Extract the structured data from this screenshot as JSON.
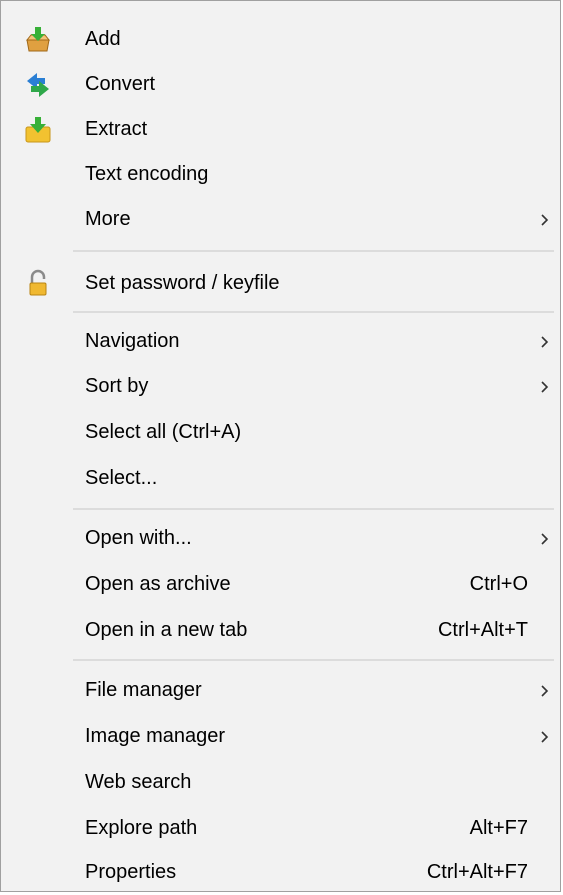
{
  "menu": {
    "items": [
      {
        "label": "Add",
        "icon": "add-archive-icon",
        "shortcut": "",
        "submenu": false
      },
      {
        "label": "Convert",
        "icon": "convert-icon",
        "shortcut": "",
        "submenu": false
      },
      {
        "label": "Extract",
        "icon": "extract-icon",
        "shortcut": "",
        "submenu": false
      },
      {
        "label": "Text encoding",
        "icon": "",
        "shortcut": "",
        "submenu": false
      },
      {
        "label": "More",
        "icon": "",
        "shortcut": "",
        "submenu": true
      },
      {
        "label": "Set password / keyfile",
        "icon": "padlock-icon",
        "shortcut": "",
        "submenu": false
      },
      {
        "label": "Navigation",
        "icon": "",
        "shortcut": "",
        "submenu": true
      },
      {
        "label": "Sort by",
        "icon": "",
        "shortcut": "",
        "submenu": true
      },
      {
        "label": "Select all (Ctrl+A)",
        "icon": "",
        "shortcut": "",
        "submenu": false
      },
      {
        "label": "Select...",
        "icon": "",
        "shortcut": "",
        "submenu": false
      },
      {
        "label": "Open with...",
        "icon": "",
        "shortcut": "",
        "submenu": true
      },
      {
        "label": "Open as archive",
        "icon": "",
        "shortcut": "Ctrl+O",
        "submenu": false
      },
      {
        "label": "Open in a new tab",
        "icon": "",
        "shortcut": "Ctrl+Alt+T",
        "submenu": false
      },
      {
        "label": "File manager",
        "icon": "",
        "shortcut": "",
        "submenu": true
      },
      {
        "label": "Image manager",
        "icon": "",
        "shortcut": "",
        "submenu": true
      },
      {
        "label": "Web search",
        "icon": "",
        "shortcut": "",
        "submenu": false
      },
      {
        "label": "Explore path",
        "icon": "",
        "shortcut": "Alt+F7",
        "submenu": false
      },
      {
        "label": "Properties",
        "icon": "",
        "shortcut": "Ctrl+Alt+F7",
        "submenu": false
      }
    ]
  },
  "colors": {
    "menu_background": "#f2f2f2",
    "separator": "#dcdcdc",
    "text": "#000000"
  }
}
